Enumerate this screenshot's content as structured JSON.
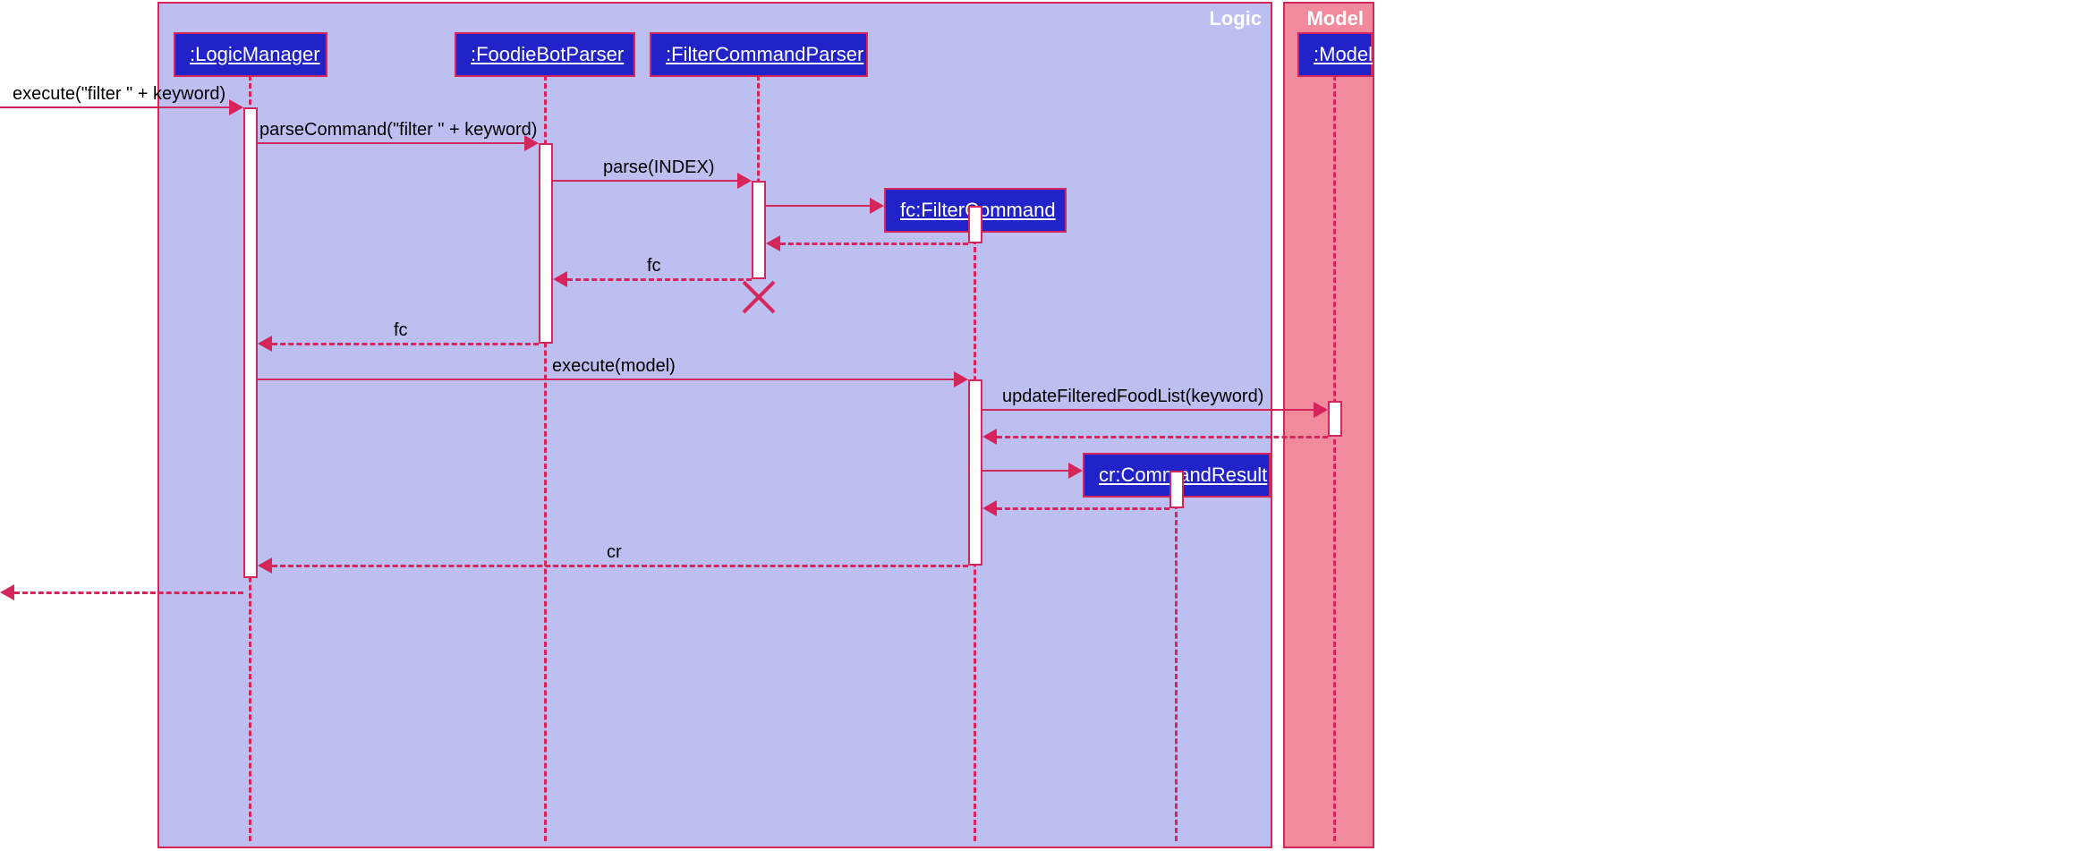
{
  "frames": {
    "logic": "Logic",
    "model": "Model"
  },
  "participants": {
    "logicManager": ":LogicManager",
    "foodieBotParser": ":FoodieBotParser",
    "filterCommandParser": ":FilterCommandParser",
    "filterCommand": "fc:FilterCommand",
    "commandResult": "cr:CommandResult",
    "model": ":Model"
  },
  "messages": {
    "m1": "execute(\"filter \" + keyword)",
    "m2": "parseCommand(\"filter \" + keyword)",
    "m3": "parse(INDEX)",
    "m5": "fc",
    "m6": "fc",
    "m7": "execute(model)",
    "m8": "updateFilteredFoodList(keyword)",
    "m10": "cr"
  }
}
